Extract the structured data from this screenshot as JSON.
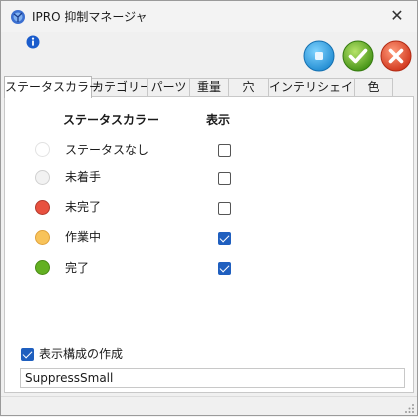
{
  "window": {
    "title": "IPRO 抑制マネージャ",
    "close_glyph": "✕"
  },
  "toolbar": {
    "info_icon": "info-icon",
    "buttons": [
      {
        "name": "blue-square-icon",
        "color": "#3aa8e0"
      },
      {
        "name": "check-icon",
        "color": "#5aa81e"
      },
      {
        "name": "cross-icon",
        "color": "#e04a2e"
      }
    ]
  },
  "tabs": [
    {
      "label": "ステータスカラー",
      "active": true
    },
    {
      "label": "カテゴリー",
      "active": false
    },
    {
      "label": "パーツ",
      "active": false
    },
    {
      "label": "重量",
      "active": false
    },
    {
      "label": "穴",
      "active": false
    },
    {
      "label": "インテリシェイプ",
      "active": false
    },
    {
      "label": "色",
      "active": false
    }
  ],
  "table": {
    "col_status": "ステータスカラー",
    "col_show": "表示",
    "rows": [
      {
        "label": "ステータスなし",
        "color": "#ffffff",
        "checked": false
      },
      {
        "label": "未着手",
        "color": "#f2f2f2",
        "checked": false
      },
      {
        "label": "未完了",
        "color": "#e8513f",
        "checked": false
      },
      {
        "label": "作業中",
        "color": "#f8c35a",
        "checked": true
      },
      {
        "label": "完了",
        "color": "#63b021",
        "checked": true
      }
    ]
  },
  "footer": {
    "create_config_label": "表示構成の作成",
    "create_config_checked": true,
    "name_value": "SuppressSmall"
  }
}
